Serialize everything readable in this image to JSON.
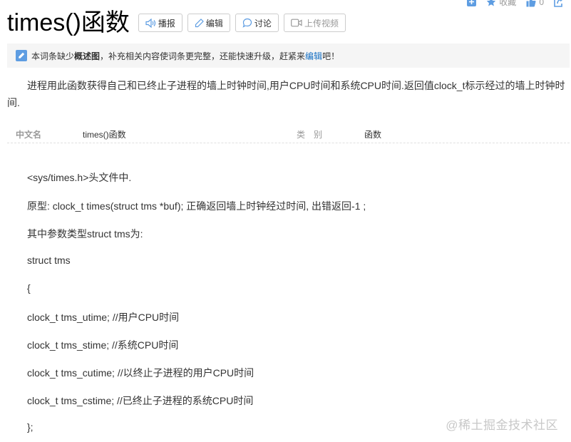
{
  "header": {
    "title": "times()函数",
    "buttons": [
      {
        "label": "播报",
        "icon": "speaker-icon"
      },
      {
        "label": "编辑",
        "icon": "pencil-icon"
      },
      {
        "label": "讨论",
        "icon": "chat-bubble-icon"
      },
      {
        "label": "上传视频",
        "icon": "video-icon"
      }
    ],
    "actions": {
      "add_icon": "plus-square-icon",
      "favorite_label": "收藏",
      "like_count": "0",
      "share_icon": "share-icon"
    }
  },
  "notice": {
    "text_before": "本词条缺少",
    "bold": "概述图",
    "text_middle": "，补充相关内容使词条更完整，还能快速升级，赶紧来",
    "link": "编辑",
    "text_after": "吧！"
  },
  "summary": "进程用此函数获得自己和已终止子进程的墙上时钟时间,用户CPU时间和系统CPU时间.返回值clock_t标示经过的墙上时钟时间.",
  "infobox": {
    "name1": "中文名",
    "value1": "times()函数",
    "name2": "类别",
    "value2": "函数"
  },
  "content": [
    "<sys/times.h>头文件中.",
    "原型: clock_t times(struct tms *buf); 正确返回墙上时钟经过时间, 出错返回-1 ;",
    "其中参数类型struct tms为:",
    "struct tms",
    "{",
    "clock_t tms_utime; //用户CPU时间",
    "clock_t tms_stime; //系统CPU时间",
    "clock_t tms_cutime; //以终止子进程的用户CPU时间",
    "clock_t tms_cstime; //已终止子进程的系统CPU时间",
    "};"
  ],
  "watermark": "@稀土掘金技术社区",
  "colors": {
    "link": "#136ec2",
    "icon_blue": "#5e9de2",
    "notice_bg": "#f5f5f5"
  }
}
